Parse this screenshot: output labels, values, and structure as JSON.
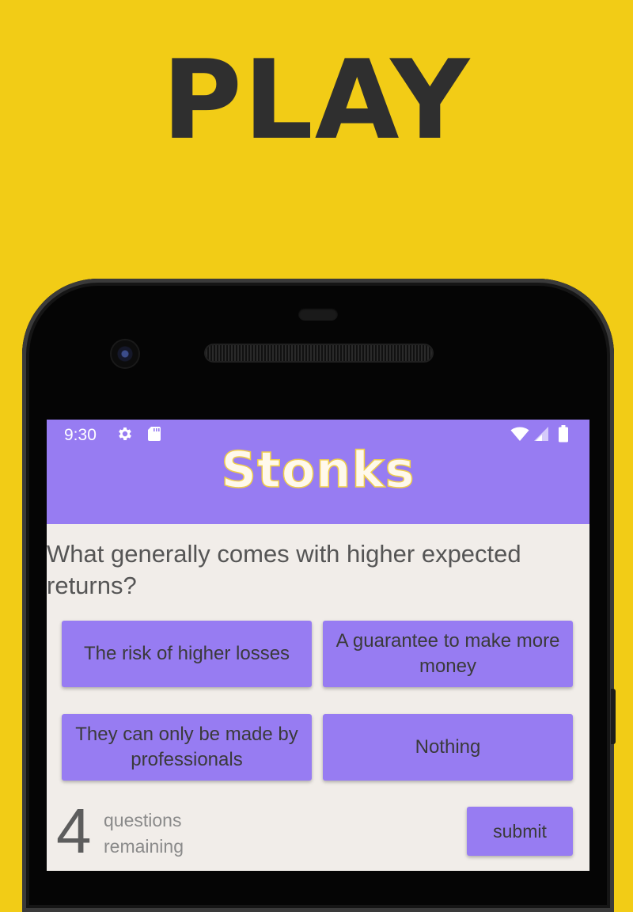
{
  "promo": {
    "headline": "PLAY"
  },
  "status_bar": {
    "time": "9:30",
    "icons": [
      "settings-icon",
      "sd-card-icon",
      "wifi-icon",
      "cell-signal-icon",
      "battery-icon"
    ]
  },
  "app": {
    "title": "Stonks"
  },
  "quiz": {
    "question": "What generally comes with higher expected returns?",
    "answers": [
      "The risk of higher losses",
      "A guarantee to make more money",
      "They can only be made by professionals",
      "Nothing"
    ],
    "remaining_count": "4",
    "remaining_label": "questions remaining",
    "submit_label": "submit"
  },
  "colors": {
    "background": "#F2CC16",
    "accent": "#977CF2",
    "screen_background": "#F1EDE9",
    "headline_text": "#2F2F2F"
  }
}
